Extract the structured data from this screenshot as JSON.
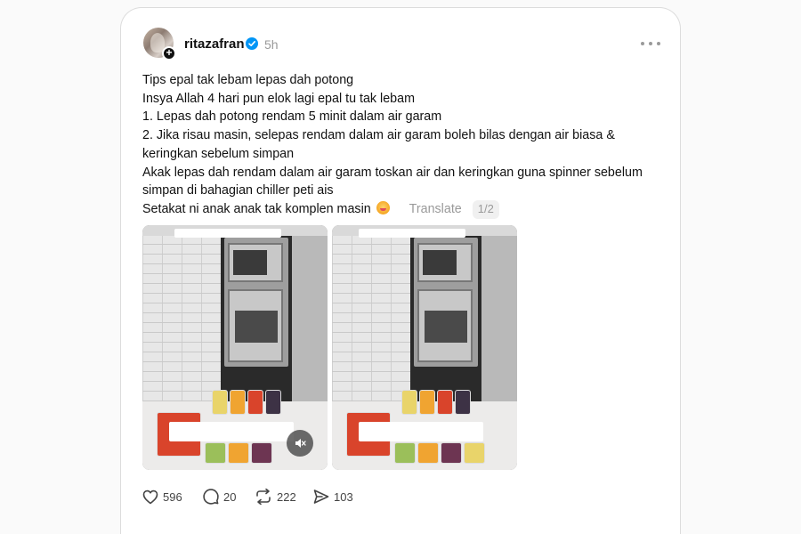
{
  "post": {
    "username": "ritazafran",
    "time": "5h",
    "lines": [
      "Tips epal tak lebam lepas dah potong",
      "Insya Allah 4 hari pun elok lagi epal tu tak lebam",
      "1. Lepas dah potong rendam 5 minit dalam air garam",
      "2. Jika risau masin, selepas rendam dalam air garam boleh bilas dengan air biasa &",
      "keringkan sebelum simpan",
      "Akak lepas dah rendam dalam air garam toskan air dan keringkan guna spinner sebelum",
      "simpan di bahagian chiller peti ais",
      "Setakat ni anak anak tak komplen masin"
    ],
    "translate_label": "Translate",
    "media_pager": "1/2"
  },
  "actions": {
    "likes": "596",
    "comments": "20",
    "reposts": "222",
    "shares": "103"
  },
  "icons": {
    "verified": "verified-badge-icon",
    "more": "more-options-icon",
    "like": "heart-icon",
    "comment": "comment-icon",
    "repost": "repost-icon",
    "share": "share-icon",
    "mute": "muted-speaker-icon"
  },
  "colors": {
    "verified": "#0095f6",
    "muted_text": "#9a9a9a"
  }
}
